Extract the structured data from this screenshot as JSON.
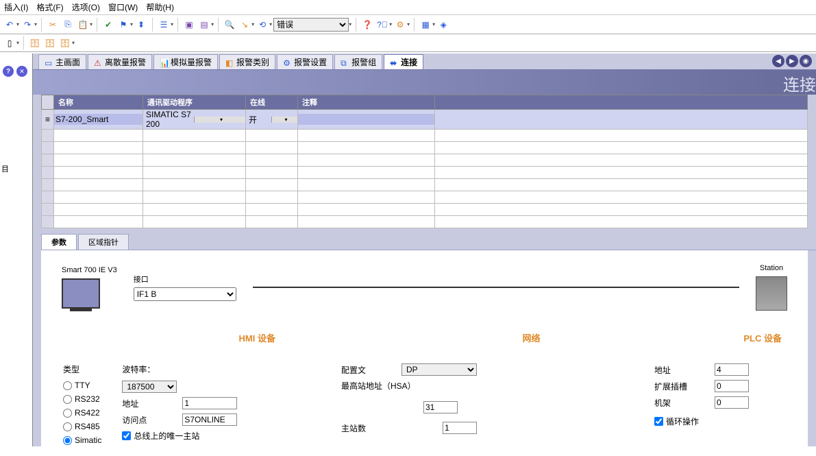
{
  "menu": {
    "insert": "插入(I)",
    "format": "格式(F)",
    "options": "选项(O)",
    "window": "窗口(W)",
    "help": "帮助(H)"
  },
  "toolbar": {
    "error_select": "错误"
  },
  "tabs": {
    "main_screen": "主画面",
    "discrete_alarm": "离散量报警",
    "analog_alarm": "模拟量报警",
    "alarm_class": "报警类别",
    "alarm_settings": "报警设置",
    "alarm_group": "报警组",
    "connection": "连接"
  },
  "banner_title": "连接",
  "grid": {
    "headers": {
      "name": "名称",
      "driver": "通讯驱动程序",
      "online": "在线",
      "comment": "注释"
    },
    "row1": {
      "name": "S7-200_Smart",
      "driver": "SIMATIC S7 200",
      "online": "开",
      "comment": ""
    }
  },
  "lower_tabs": {
    "params": "参数",
    "area_ptr": "区域指针"
  },
  "devices": {
    "hmi_label": "Smart 700 IE V3",
    "station_label": "Station",
    "iface_label": "接口",
    "iface_value": "IF1 B"
  },
  "sections": {
    "hmi": "HMI 设备",
    "network": "网络",
    "plc": "PLC 设备"
  },
  "hmi_form": {
    "type_label": "类型",
    "tty": "TTY",
    "rs232": "RS232",
    "rs422": "RS422",
    "rs485": "RS485",
    "simatic": "Simatic",
    "baud_label": "波特率：",
    "baud_value": "187500",
    "addr_label": "地址",
    "addr_value": "1",
    "access_label": "访问点",
    "access_value": "S7ONLINE",
    "only_master": "总线上的唯一主站"
  },
  "net_form": {
    "profile_label": "配置文",
    "profile_value": "DP",
    "hsa_label": "最高站地址（HSA）",
    "hsa_value": "31",
    "master_count_label": "主站数",
    "master_count_value": "1"
  },
  "plc_form": {
    "addr_label": "地址",
    "addr_value": "4",
    "slot_label": "扩展插槽",
    "slot_value": "0",
    "rack_label": "机架",
    "rack_value": "0",
    "cyclic": "循环操作"
  },
  "left_label": "目"
}
